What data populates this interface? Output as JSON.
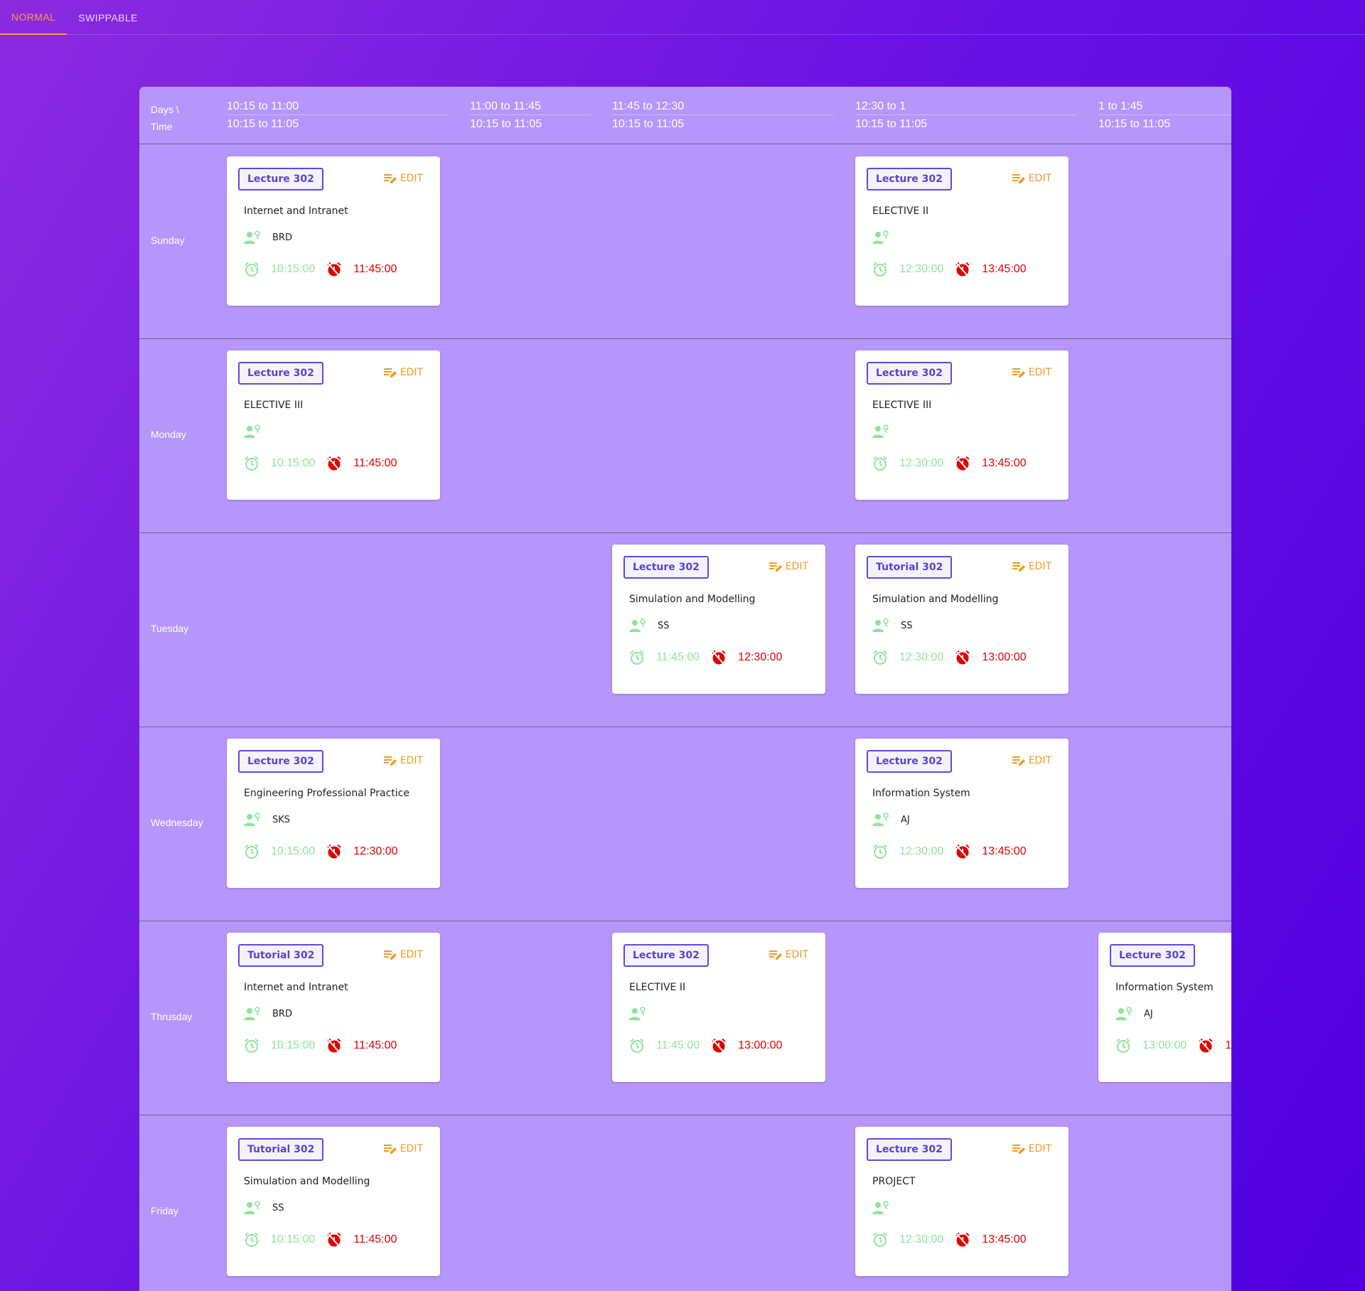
{
  "tabs": [
    {
      "label": "NORMAL",
      "active": true
    },
    {
      "label": "SWIPPABLE",
      "active": false
    }
  ],
  "header": {
    "label_line1": "Days \\",
    "label_line2": "Time",
    "columns": [
      {
        "top": "10:15 to 11:00",
        "bottom": "10:15 to 11:05"
      },
      {
        "top": "11:00 to 11:45",
        "bottom": "10:15 to 11:05"
      },
      {
        "top": "11:45 to 12:30",
        "bottom": "10:15 to 11:05"
      },
      {
        "top": "12:30 to 1",
        "bottom": "10:15 to 11:05"
      },
      {
        "top": "1 to 1:45",
        "bottom": "10:15 to 11:05"
      }
    ]
  },
  "edit_label": "EDIT",
  "colors": {
    "accent": "#ff9a3c",
    "type_badge": "#5b43c9",
    "start_time": "#8fe39a",
    "end_time": "#e00000"
  },
  "days": [
    {
      "name": "Sunday",
      "cards": [
        {
          "col": 0,
          "type": "Lecture 302",
          "subject": "Internet and Intranet",
          "teacher": "BRD",
          "start": "10:15:00",
          "end": "11:45:00"
        },
        {
          "col": 3,
          "type": "Lecture 302",
          "subject": "ELECTIVE II",
          "teacher": "",
          "start": "12:30:00",
          "end": "13:45:00"
        }
      ]
    },
    {
      "name": "Monday",
      "cards": [
        {
          "col": 0,
          "type": "Lecture 302",
          "subject": "ELECTIVE III",
          "teacher": "",
          "start": "10:15:00",
          "end": "11:45:00"
        },
        {
          "col": 3,
          "type": "Lecture 302",
          "subject": "ELECTIVE III",
          "teacher": "",
          "start": "12:30:00",
          "end": "13:45:00"
        }
      ]
    },
    {
      "name": "Tuesday",
      "cards": [
        {
          "col": 2,
          "type": "Lecture 302",
          "subject": "Simulation and Modelling",
          "teacher": "SS",
          "start": "11:45:00",
          "end": "12:30:00"
        },
        {
          "col": 3,
          "type": "Tutorial 302",
          "subject": "Simulation and Modelling",
          "teacher": "SS",
          "start": "12:30:00",
          "end": "13:00:00"
        }
      ]
    },
    {
      "name": "Wednesday",
      "cards": [
        {
          "col": 0,
          "type": "Lecture 302",
          "subject": "Engineering Professional Practice",
          "teacher": "SKS",
          "start": "10:15:00",
          "end": "12:30:00"
        },
        {
          "col": 3,
          "type": "Lecture 302",
          "subject": "Information System",
          "teacher": "AJ",
          "start": "12:30:00",
          "end": "13:45:00"
        }
      ]
    },
    {
      "name": "Thrusday",
      "cards": [
        {
          "col": 0,
          "type": "Tutorial 302",
          "subject": "Internet and Intranet",
          "teacher": "BRD",
          "start": "10:15:00",
          "end": "11:45:00"
        },
        {
          "col": 2,
          "type": "Lecture 302",
          "subject": "ELECTIVE II",
          "teacher": "",
          "start": "11:45:00",
          "end": "13:00:00"
        },
        {
          "col": 4,
          "type": "Lecture 302",
          "subject": "Information System",
          "teacher": "AJ",
          "start": "13:00:00",
          "end": "1"
        }
      ]
    },
    {
      "name": "Friday",
      "cards": [
        {
          "col": 0,
          "type": "Tutorial 302",
          "subject": "Simulation and Modelling",
          "teacher": "SS",
          "start": "10:15:00",
          "end": "11:45:00"
        },
        {
          "col": 3,
          "type": "Lecture 302",
          "subject": "PROJECT",
          "teacher": "",
          "start": "12:30:00",
          "end": "13:45:00"
        }
      ]
    }
  ]
}
